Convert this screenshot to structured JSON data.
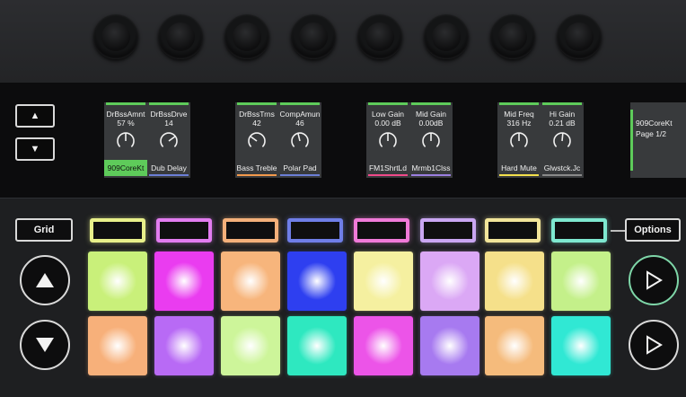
{
  "knobs": [
    {
      "name": "knob-1"
    },
    {
      "name": "knob-2"
    },
    {
      "name": "knob-3"
    },
    {
      "name": "knob-4"
    },
    {
      "name": "knob-5"
    },
    {
      "name": "knob-6"
    },
    {
      "name": "knob-7"
    },
    {
      "name": "knob-8"
    }
  ],
  "nav": {
    "up_icon": "triangle-up-icon",
    "down_icon": "triangle-down-icon"
  },
  "screens": [
    {
      "params": [
        {
          "name": "DrBssAmnt",
          "value": "57 %",
          "knob": 0.5,
          "slot": "909CoreKt",
          "slot_color": "#5ecb5a",
          "slot_selected": true
        },
        {
          "name": "DrBssDrve",
          "value": "14",
          "knob": 0.7,
          "slot": "Dub Delay",
          "slot_color": "#6b7fd6",
          "slot_selected": false
        }
      ]
    },
    {
      "params": [
        {
          "name": "DrBssTrns",
          "value": "42",
          "knob": 0.3,
          "slot": "Bass Treble",
          "slot_color": "#f39a4c",
          "slot_selected": false
        },
        {
          "name": "CompAmun",
          "value": "46",
          "knob": 0.45,
          "slot": "Polar Pad",
          "slot_color": "#6b7fd6",
          "slot_selected": false
        }
      ]
    },
    {
      "params": [
        {
          "name": "Low Gain",
          "value": "0.00 dB",
          "knob": 0.5,
          "slot": "FM1ShrtLd",
          "slot_color": "#f04a8a",
          "slot_selected": false
        },
        {
          "name": "Mid Gain",
          "value": "0.00dB",
          "knob": 0.5,
          "slot": "Mrmb1Clss",
          "slot_color": "#9b7fe0",
          "slot_selected": false
        }
      ]
    },
    {
      "params": [
        {
          "name": "Mid Freq",
          "value": "316 Hz",
          "knob": 0.5,
          "slot": "Hard Mute",
          "slot_color": "#f3e04c",
          "slot_selected": false
        },
        {
          "name": "Hi Gain",
          "value": "0.21 dB",
          "knob": 0.52,
          "slot": "Glwstck.Jc",
          "slot_color": "#8a8a8a",
          "slot_selected": false
        }
      ]
    }
  ],
  "info": {
    "line1": "909CoreKt",
    "line2": "Page 1/2",
    "accent": "#5ecb5a"
  },
  "grid_button": {
    "label": "Grid"
  },
  "options_button": {
    "label": "Options"
  },
  "slot_buttons": [
    {
      "color": "#e8f08a"
    },
    {
      "color": "#e27cf0"
    },
    {
      "color": "#f4b07a"
    },
    {
      "color": "#6f7ee8"
    },
    {
      "color": "#f07ad8"
    },
    {
      "color": "#c9a6f2"
    },
    {
      "color": "#f2e59a"
    },
    {
      "color": "#7ee8d0"
    }
  ],
  "pads_row1": [
    {
      "color": "#c9f07a"
    },
    {
      "color": "#ea3cf0"
    },
    {
      "color": "#f7b57c"
    },
    {
      "color": "#2e3ff0"
    },
    {
      "color": "#f5f0a0"
    },
    {
      "color": "#dba8f5"
    },
    {
      "color": "#f5e08a"
    },
    {
      "color": "#c4f08a"
    }
  ],
  "pads_row2": [
    {
      "color": "#f7b07a"
    },
    {
      "color": "#b86af5"
    },
    {
      "color": "#cdf59a"
    },
    {
      "color": "#2ee8c0"
    },
    {
      "color": "#ec54e8"
    },
    {
      "color": "#a77af0"
    },
    {
      "color": "#f5bb7c"
    },
    {
      "color": "#30e8d4"
    }
  ],
  "side_buttons": {
    "up_icon": "triangle-up-icon",
    "down_icon": "triangle-down-icon",
    "play1_icon": "play-icon",
    "play2_icon": "play-icon"
  }
}
